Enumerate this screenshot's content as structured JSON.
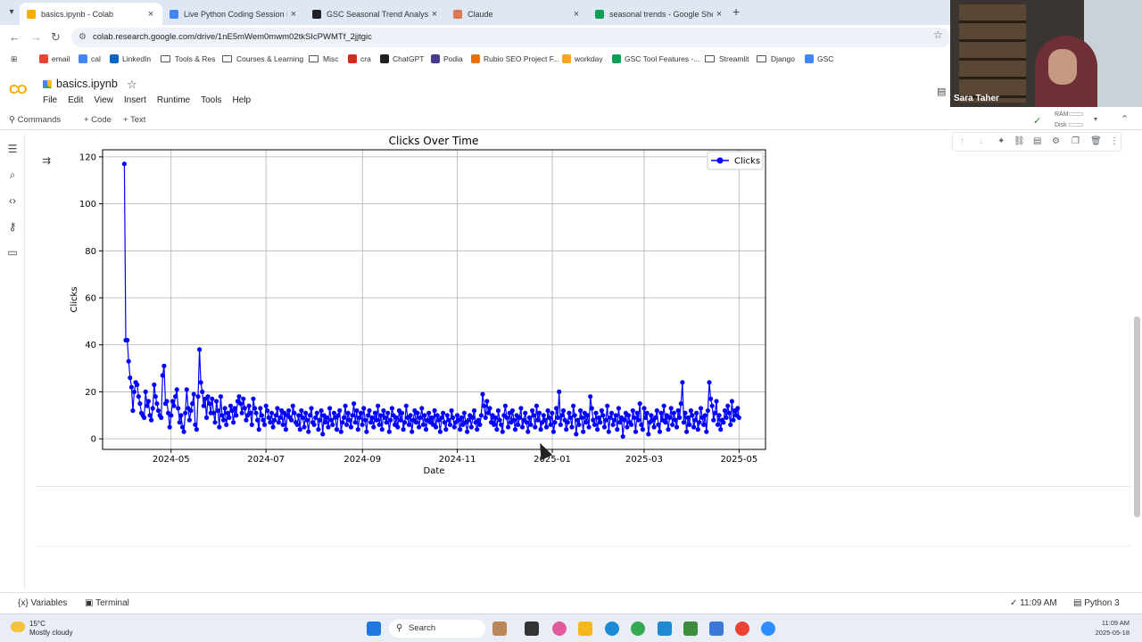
{
  "browser": {
    "tabs": [
      {
        "title": "basics.ipynb - Colab",
        "active": true,
        "favicon_color": "#f9ab00"
      },
      {
        "title": "Live Python Coding Session Pro",
        "active": false,
        "favicon_color": "#4285f4"
      },
      {
        "title": "GSC Seasonal Trend Analysis",
        "active": false,
        "favicon_color": "#202124"
      },
      {
        "title": "Claude",
        "active": false,
        "favicon_color": "#d97757"
      },
      {
        "title": "seasonal trends - Google Sheet",
        "active": false,
        "favicon_color": "#0f9d58"
      }
    ],
    "new_tab": "+",
    "close_glyph": "×",
    "url": "colab.research.google.com/drive/1nE5mWem0mwm02tkSIcPWMTf_2jjtgic",
    "bookmarks": [
      {
        "label": "email",
        "icon": "gmail-icon"
      },
      {
        "label": "cal",
        "icon": "calendar-icon"
      },
      {
        "label": "LinkedIn",
        "icon": "linkedin-icon"
      },
      {
        "label": "Tools & Res",
        "icon": "folder-icon"
      },
      {
        "label": "Courses & Learning",
        "icon": "folder-icon"
      },
      {
        "label": "Misc",
        "icon": "folder-icon"
      },
      {
        "label": "cra",
        "icon": "maple-leaf-icon"
      },
      {
        "label": "ChatGPT",
        "icon": "chatgpt-icon"
      },
      {
        "label": "Podia",
        "icon": "podia-icon"
      },
      {
        "label": "Rubio SEO Project F...",
        "icon": "rubio-icon"
      },
      {
        "label": "workday",
        "icon": "workday-icon"
      },
      {
        "label": "GSC Tool Features -...",
        "icon": "sheets-icon"
      },
      {
        "label": "Streamlit",
        "icon": "folder-icon"
      },
      {
        "label": "Django",
        "icon": "folder-icon"
      },
      {
        "label": "GSC",
        "icon": "gsc-icon"
      }
    ]
  },
  "webcam": {
    "name": "Sara Taher"
  },
  "colab": {
    "notebook_name": "basics.ipynb",
    "menu": [
      "File",
      "Edit",
      "View",
      "Insert",
      "Runtime",
      "Tools",
      "Help"
    ],
    "toolbar": {
      "commands": "Commands",
      "code": "+ Code",
      "text": "+ Text"
    },
    "resources": {
      "ram": "RAM",
      "disk": "Disk"
    }
  },
  "statusbar": {
    "variables": "Variables",
    "terminal": "Terminal",
    "time": "✓ 11:09 AM",
    "kernel": "Python 3"
  },
  "taskbar": {
    "weather_temp": "15°C",
    "weather_desc": "Mostly cloudy",
    "search": "Search",
    "clock_time": "11:09 AM",
    "clock_date": "2025-05-18"
  },
  "chart_data": {
    "type": "line",
    "title": "Clicks Over Time",
    "xlabel": "Date",
    "ylabel": "Clicks",
    "x_ticks": [
      "2024-05",
      "2024-07",
      "2024-09",
      "2024-11",
      "2025-01",
      "2025-03",
      "2025-05"
    ],
    "x_range": [
      "2024-03-18",
      "2025-05-18"
    ],
    "y_ticks": [
      0,
      20,
      40,
      60,
      80,
      100,
      120
    ],
    "ylim": [
      -4.5,
      123
    ],
    "grid": true,
    "legend": "top-right",
    "marker": "circle",
    "color": "#0000ff",
    "series": [
      {
        "name": "Clicks",
        "start_date": "2024-04-01",
        "end_date": "2025-05-01",
        "values": [
          117,
          42,
          42,
          33,
          26,
          22,
          12,
          20,
          24,
          23,
          18,
          15,
          11,
          10,
          9,
          20,
          14,
          16,
          10,
          8,
          13,
          23,
          18,
          15,
          12,
          10,
          9,
          27,
          31,
          15,
          16,
          11,
          5,
          10,
          16,
          14,
          18,
          21,
          13,
          7,
          10,
          5,
          3,
          11,
          21,
          13,
          8,
          12,
          15,
          19,
          6,
          4,
          18,
          38,
          24,
          20,
          14,
          17,
          9,
          18,
          15,
          11,
          17,
          11,
          7,
          16,
          12,
          5,
          18,
          10,
          8,
          13,
          6,
          11,
          9,
          14,
          12,
          7,
          13,
          10,
          16,
          18,
          15,
          11,
          17,
          13,
          8,
          10,
          14,
          11,
          6,
          17,
          13,
          11,
          8,
          4,
          13,
          10,
          8,
          6,
          14,
          12,
          9,
          7,
          11,
          5,
          8,
          10,
          13,
          7,
          9,
          12,
          6,
          11,
          4,
          10,
          12,
          9,
          8,
          14,
          11,
          7,
          6,
          10,
          4,
          12,
          9,
          5,
          11,
          8,
          3,
          10,
          13,
          7,
          6,
          9,
          11,
          4,
          8,
          12,
          2,
          10,
          7,
          9,
          5,
          13,
          8,
          6,
          11,
          9,
          4,
          10,
          12,
          3,
          7,
          9,
          14,
          6,
          11,
          8,
          5,
          10,
          15,
          7,
          12,
          4,
          9,
          11,
          6,
          13,
          8,
          3,
          10,
          12,
          7,
          9,
          5,
          11,
          8,
          14,
          6,
          10,
          4,
          12,
          9,
          7,
          11,
          3,
          8,
          13,
          10,
          6,
          9,
          5,
          12,
          8,
          11,
          4,
          7,
          14,
          9,
          6,
          10,
          3,
          8,
          12,
          7,
          11,
          5,
          9,
          13,
          6,
          10,
          4,
          8,
          11,
          7,
          9,
          6,
          12,
          5,
          10,
          8,
          3,
          9,
          11,
          7,
          4,
          10,
          8,
          6,
          12,
          9,
          5,
          7,
          10,
          8,
          4,
          9,
          6,
          11,
          7,
          3,
          8,
          10,
          5,
          9,
          12,
          7,
          4,
          8,
          6,
          10,
          19,
          14,
          9,
          16,
          11,
          13,
          7,
          10,
          6,
          9,
          4,
          12,
          8,
          6,
          3,
          10,
          14,
          9,
          5,
          11,
          7,
          12,
          8,
          4,
          10,
          6,
          9,
          13,
          5,
          8,
          11,
          7,
          3,
          9,
          6,
          12,
          10,
          5,
          14,
          8,
          11,
          4,
          7,
          10,
          8,
          5,
          12,
          9,
          6,
          11,
          3,
          7,
          13,
          9,
          20,
          6,
          10,
          12,
          8,
          4,
          7,
          11,
          9,
          5,
          14,
          10,
          2,
          8,
          6,
          12,
          9,
          3,
          11,
          7,
          10,
          5,
          18,
          13,
          8,
          6,
          11,
          4,
          9,
          7,
          12,
          10,
          5,
          8,
          14,
          3,
          9,
          11,
          6,
          8,
          10,
          4,
          13,
          7,
          9,
          1,
          8,
          11,
          5,
          10,
          7,
          6,
          12,
          9,
          3,
          11,
          8,
          15,
          6,
          4,
          13,
          9,
          11,
          2,
          7,
          10,
          8,
          5,
          9,
          12,
          6,
          3,
          11,
          8,
          14,
          7,
          10,
          4,
          9,
          13,
          6,
          11,
          8,
          5,
          12,
          9,
          15,
          24,
          7,
          11,
          3,
          9,
          6,
          12,
          10,
          5,
          8,
          11,
          4,
          7,
          13,
          9,
          6,
          10,
          3,
          12,
          24,
          17,
          14,
          8,
          11,
          16,
          6,
          10,
          4,
          8,
          7,
          12,
          9,
          14,
          11,
          6,
          16,
          8,
          12,
          10,
          13,
          9
        ]
      }
    ]
  }
}
